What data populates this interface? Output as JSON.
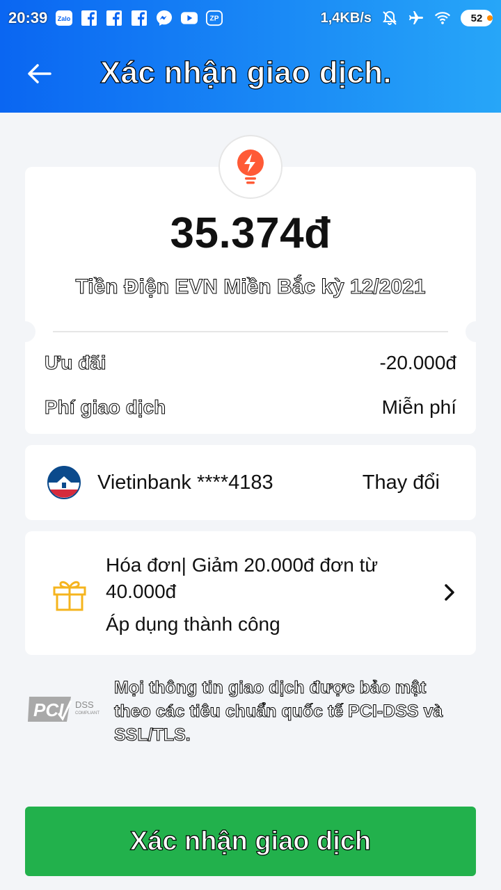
{
  "status_bar": {
    "time": "20:39",
    "notification_icons": [
      "zalo-icon",
      "facebook-icon",
      "facebook-icon",
      "facebook-icon",
      "messenger-icon",
      "youtube-icon",
      "zalopay-icon"
    ],
    "zalo_label": "Zalo",
    "zp_label": "ZP",
    "network_speed": "1,4KB/s",
    "battery": "52"
  },
  "header": {
    "title": "Xác nhận giao dịch."
  },
  "summary": {
    "amount": "35.374đ",
    "bill_name": "Tiền Điện EVN Miền Bắc kỳ 12/2021",
    "discount_label": "Ưu đãi",
    "discount_value": "-20.000đ",
    "fee_label": "Phí giao dịch",
    "fee_value": "Miễn phí"
  },
  "payment": {
    "bank": "Vietinbank ****4183",
    "change_label": "Thay đổi"
  },
  "promo": {
    "title": "Hóa đơn| Giảm 20.000đ đơn từ 40.000đ",
    "status": "Áp dụng thành công"
  },
  "security": {
    "note": "Mọi thông tin giao dịch được bảo mật theo các tiêu chuẩn quốc tế PCI-DSS và SSL/TLS.",
    "pci_text": "PCI",
    "dss_text": "DSS",
    "compliant_text": "COMPLIANT"
  },
  "confirm_button": {
    "label": "Xác nhận giao dịch"
  },
  "colors": {
    "header_start": "#0a66f2",
    "header_end": "#27a6f8",
    "confirm": "#22b14c",
    "bolt": "#ff5a36",
    "gift": "#f5b41e",
    "bank_blue": "#0b4a8c",
    "bank_red": "#d52b3c"
  }
}
